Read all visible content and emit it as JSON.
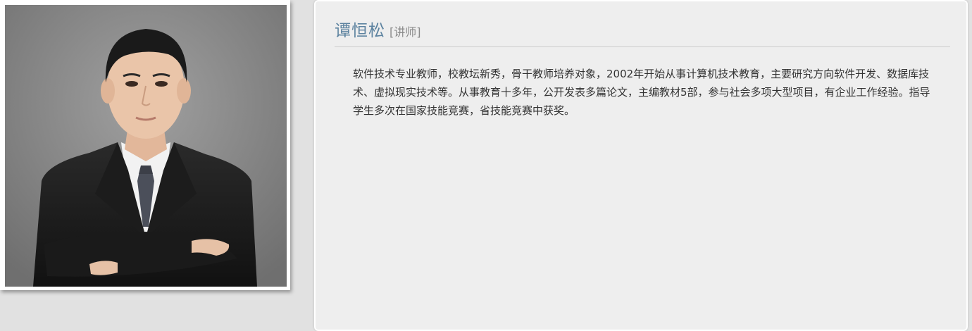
{
  "teacher": {
    "name": "谭恒松",
    "title": "[讲师]",
    "bio": "软件技术专业教师，校教坛新秀，骨干教师培养对象，2002年开始从事计算机技术教育，主要研究方向软件开发、数据库技术、虚拟现实技术等。从事教育十多年，公开发表多篇论文，主编教材5部，参与社会多项大型项目，有企业工作经验。指导学生多次在国家技能竞赛，省技能竞赛中获奖。"
  },
  "colors": {
    "name": "#5d83a0",
    "panel_bg": "#eeeeee",
    "page_bg": "#e1e1e1"
  }
}
